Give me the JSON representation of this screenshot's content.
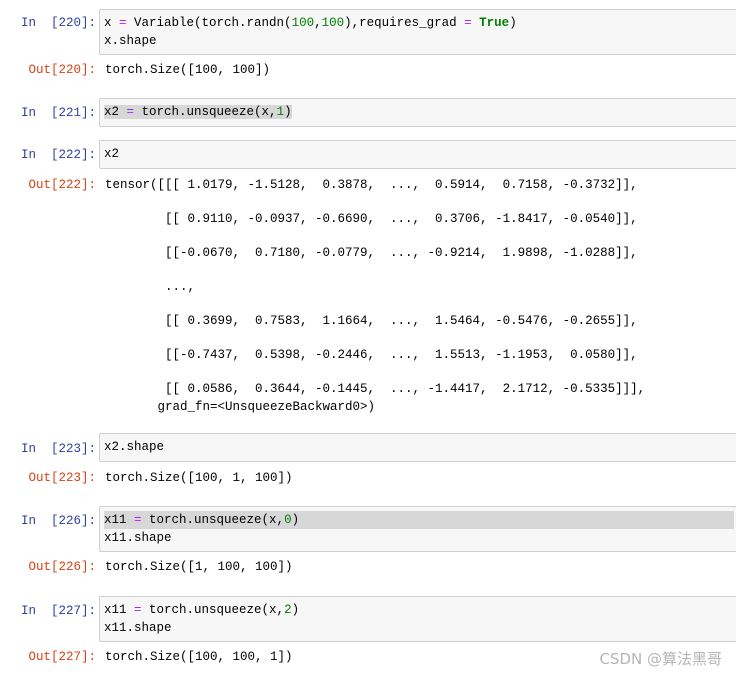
{
  "cells": [
    {
      "in_prompt": "In  [220]:",
      "input": {
        "l1": {
          "a": "x ",
          "op": "=",
          "b": " Variable(torch.randn(",
          "n1": "100",
          "c": ",",
          "n2": "100",
          "d": "),requires_grad ",
          "op2": "=",
          "e": " ",
          "kw": "True",
          "f": ")"
        },
        "l2": "x.shape"
      },
      "out_prompt": "Out[220]:",
      "output": "torch.Size([100, 100])"
    },
    {
      "in_prompt": "In  [221]:",
      "input": {
        "a": "x2 ",
        "op": "=",
        "b": " torch.unsqueeze(x,",
        "n": "1",
        "c": ")"
      }
    },
    {
      "in_prompt": "In  [222]:",
      "input": "x2",
      "out_prompt": "Out[222]:",
      "output_lines": [
        "tensor([[[ 1.0179, -1.5128,  0.3878,  ...,  0.5914,  0.7158, -0.3732]],",
        "        [[ 0.9110, -0.0937, -0.6690,  ...,  0.3706, -1.8417, -0.0540]],",
        "        [[-0.0670,  0.7180, -0.0779,  ..., -0.9214,  1.9898, -1.0288]],",
        "        ...,",
        "        [[ 0.3699,  0.7583,  1.1664,  ...,  1.5464, -0.5476, -0.2655]],",
        "        [[-0.7437,  0.5398, -0.2446,  ...,  1.5513, -1.1953,  0.0580]],",
        "        [[ 0.0586,  0.3644, -0.1445,  ..., -1.4417,  2.1712, -0.5335]]],",
        "       grad_fn=<UnsqueezeBackward0>)"
      ]
    },
    {
      "in_prompt": "In  [223]:",
      "input": "x2.shape",
      "out_prompt": "Out[223]:",
      "output": "torch.Size([100, 1, 100])"
    },
    {
      "in_prompt": "In  [226]:",
      "input": {
        "l1": {
          "a": "x11 ",
          "op": "=",
          "b": " torch.unsqueeze(x,",
          "n": "0",
          "c": ")"
        },
        "l2": "x11.shape"
      },
      "out_prompt": "Out[226]:",
      "output": "torch.Size([1, 100, 100])"
    },
    {
      "in_prompt": "In  [227]:",
      "input": {
        "l1": {
          "a": "x11 ",
          "op": "=",
          "b": " torch.unsqueeze(x,",
          "n": "2",
          "c": ")"
        },
        "l2": "x11.shape"
      },
      "out_prompt": "Out[227]:",
      "output": "torch.Size([100, 100, 1])"
    }
  ],
  "watermark": "CSDN @算法黑哥",
  "colors": {
    "in_prompt": "#303f9f",
    "out_prompt": "#d84315",
    "operator": "#aa22ff",
    "number": "#008000"
  }
}
